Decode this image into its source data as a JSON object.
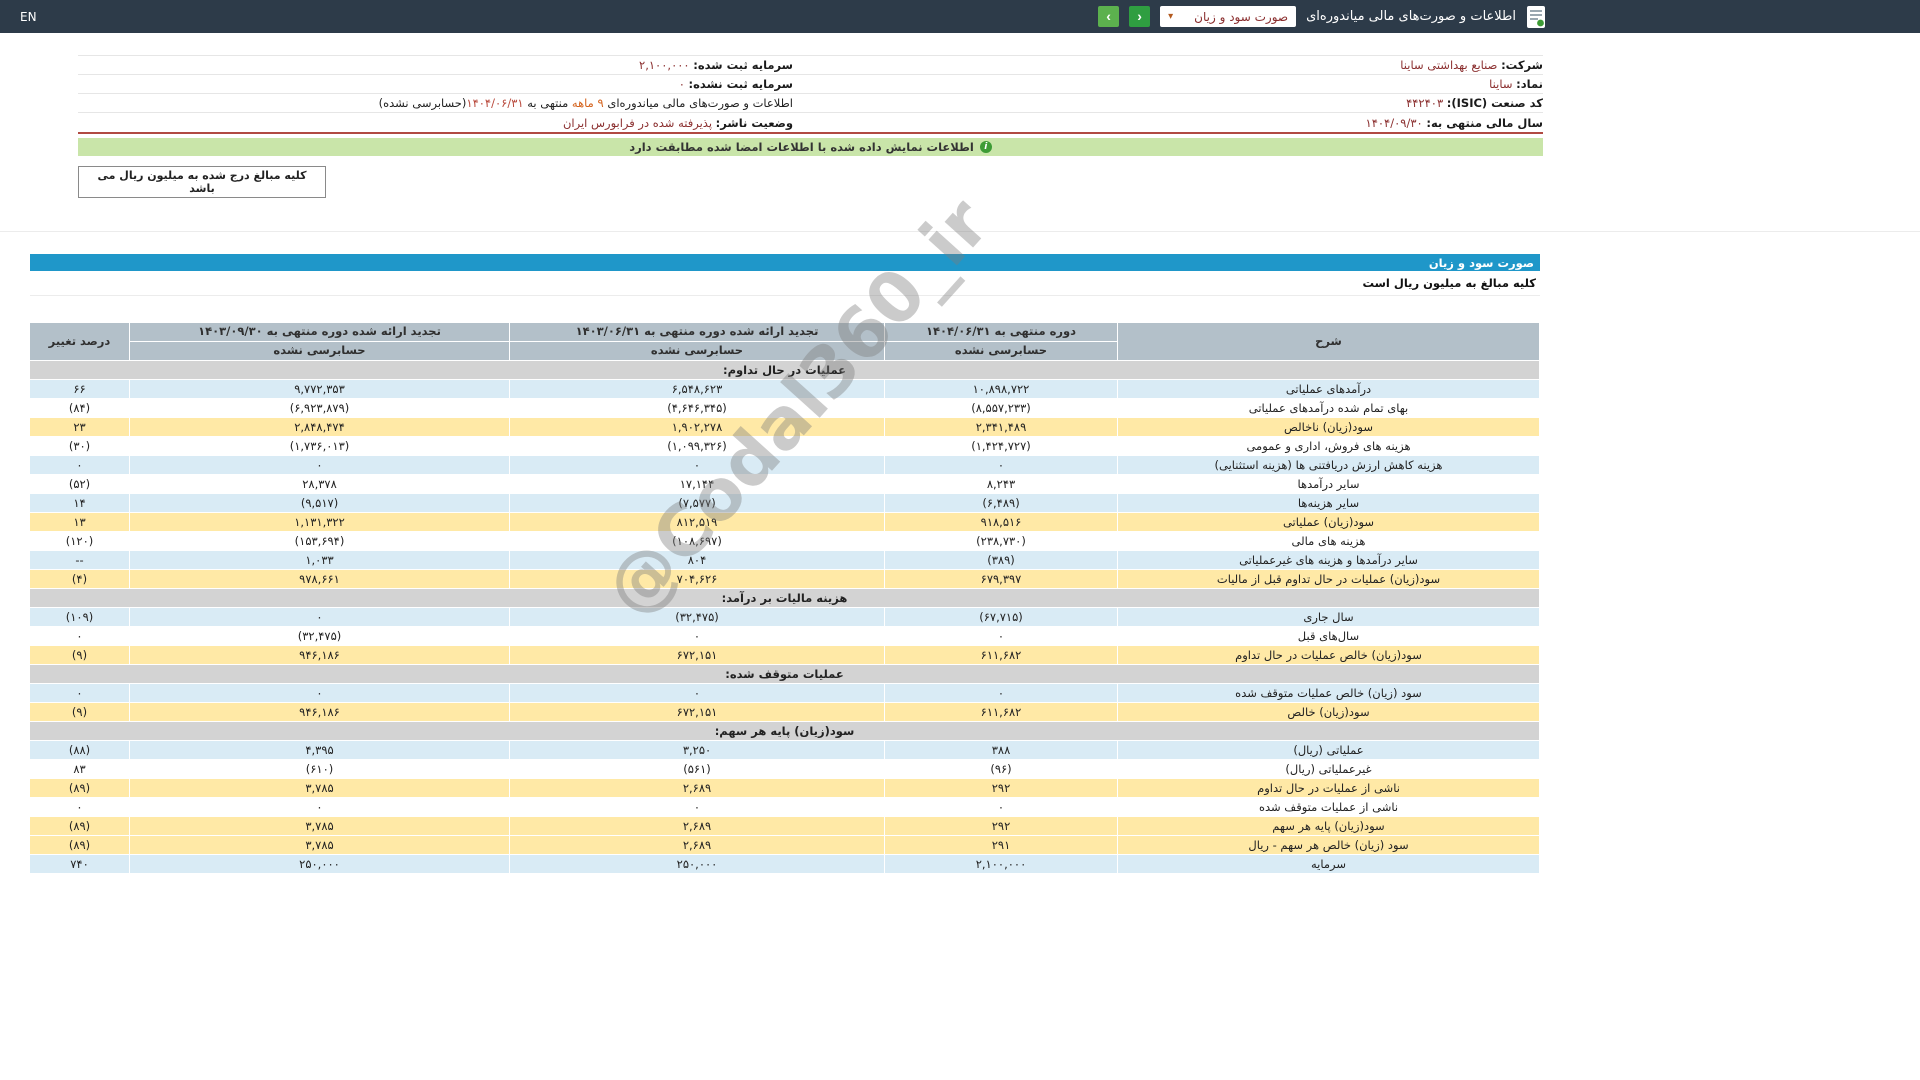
{
  "topbar": {
    "title": "اطلاعات و صورت‌های مالی میاندوره‌ای",
    "statement_select": "صورت سود و زیان",
    "lang_label": "EN",
    "nav": {
      "next": "›",
      "prev": "‹"
    }
  },
  "company": {
    "right": [
      {
        "label": "شرکت:",
        "value": "صنایع بهداشتی ساینا"
      },
      {
        "label": "نماد:",
        "value": "ساینا"
      },
      {
        "label": "کد صنعت (ISIC):",
        "value": "۴۴۲۴۰۳"
      },
      {
        "label": "سال مالی منتهی به:",
        "value": "۱۴۰۴/۰۹/۳۰"
      }
    ],
    "left": [
      {
        "label": "سرمایه ثبت شده:",
        "value": "۲,۱۰۰,۰۰۰"
      },
      {
        "label": "سرمایه ثبت نشده:",
        "value": "۰"
      },
      {
        "label": "اطلاعات و صورت‌های مالی میاندوره‌ای",
        "period": "۹ ماهه",
        "mid": "منتهی به",
        "date": "۱۴۰۴/۰۶/۳۱",
        "note": "(حسابرسی نشده)"
      },
      {
        "label": "وضعیت ناشر:",
        "value": "پذیرفته شده در فرابورس ایران"
      }
    ]
  },
  "banner": {
    "text": "اطلاعات نمایش داده شده با اطلاعات امضا شده مطابقت دارد",
    "icon": "i"
  },
  "unit_note": "کلیه مبالغ درج شده به میلیون ریال می باشد",
  "statement": {
    "title": "صورت سود و زیان",
    "unit_row": "کلیه مبالغ به میلیون ریال است",
    "columns": {
      "desc": "شرح",
      "p1": "دوره منتهی به ۱۴۰۴/۰۶/۳۱",
      "p2": "تجدید ارائه شده دوره منتهی به ۱۴۰۳/۰۶/۳۱",
      "p3": "تجدید ارائه شده دوره منتهی به ۱۴۰۳/۰۹/۳۰",
      "audit1": "حسابرسی نشده",
      "audit2": "حسابرسی نشده",
      "audit3": "حسابرسی نشده",
      "pct": "درصد تغییر"
    },
    "rows": [
      {
        "type": "section",
        "label": "عملیات در حال تداوم:"
      },
      {
        "type": "blue",
        "label": "درآمدهای عملیاتی",
        "v1": "۱۰,۸۹۸,۷۲۲",
        "v2": "۶,۵۴۸,۶۲۳",
        "v3": "۹,۷۷۲,۳۵۳",
        "pct": "۶۶"
      },
      {
        "type": "white",
        "label": "بهای تمام شده درآمدهای عملیاتی",
        "v1": "(۸,۵۵۷,۲۳۳)",
        "v2": "(۴,۶۴۶,۳۴۵)",
        "v3": "(۶,۹۲۳,۸۷۹)",
        "pct": "(۸۴)"
      },
      {
        "type": "yellow",
        "label": "سود(زیان) ناخالص",
        "v1": "۲,۳۴۱,۴۸۹",
        "v2": "۱,۹۰۲,۲۷۸",
        "v3": "۲,۸۴۸,۴۷۴",
        "pct": "۲۳"
      },
      {
        "type": "white",
        "label": "هزینه های فروش، اداری و عمومی",
        "v1": "(۱,۴۲۴,۷۲۷)",
        "v2": "(۱,۰۹۹,۳۲۶)",
        "v3": "(۱,۷۳۶,۰۱۳)",
        "pct": "(۳۰)"
      },
      {
        "type": "blue",
        "label": "هزینه کاهش ارزش دریافتنی ها (هزینه استثنایی)",
        "v1": "۰",
        "v2": "۰",
        "v3": "۰",
        "pct": "۰"
      },
      {
        "type": "white",
        "label": "سایر درآمدها",
        "v1": "۸,۲۴۳",
        "v2": "۱۷,۱۴۴",
        "v3": "۲۸,۳۷۸",
        "pct": "(۵۲)"
      },
      {
        "type": "blue",
        "label": "سایر هزینه‌ها",
        "v1": "(۶,۴۸۹)",
        "v2": "(۷,۵۷۷)",
        "v3": "(۹,۵۱۷)",
        "pct": "۱۴"
      },
      {
        "type": "yellow",
        "label": "سود(زیان) عملیاتی",
        "v1": "۹۱۸,۵۱۶",
        "v2": "۸۱۲,۵۱۹",
        "v3": "۱,۱۳۱,۳۲۲",
        "pct": "۱۳"
      },
      {
        "type": "white",
        "label": "هزینه های مالی",
        "v1": "(۲۳۸,۷۳۰)",
        "v2": "(۱۰۸,۶۹۷)",
        "v3": "(۱۵۳,۶۹۴)",
        "pct": "(۱۲۰)"
      },
      {
        "type": "blue",
        "label": "سایر درآمدها و هزینه های غیرعملیاتی",
        "v1": "(۳۸۹)",
        "v2": "۸۰۴",
        "v3": "۱,۰۳۳",
        "pct": "--"
      },
      {
        "type": "yellow",
        "label": "سود(زیان) عملیات در حال تداوم قبل از مالیات",
        "v1": "۶۷۹,۳۹۷",
        "v2": "۷۰۴,۶۲۶",
        "v3": "۹۷۸,۶۶۱",
        "pct": "(۴)"
      },
      {
        "type": "section",
        "label": "هزینه مالیات بر درآمد:"
      },
      {
        "type": "blue",
        "label": "سال جاری",
        "v1": "(۶۷,۷۱۵)",
        "v2": "(۳۲,۴۷۵)",
        "v3": "۰",
        "pct": "(۱۰۹)"
      },
      {
        "type": "white",
        "label": "سال‌های قبل",
        "v1": "۰",
        "v2": "۰",
        "v3": "(۳۲,۴۷۵)",
        "pct": "۰"
      },
      {
        "type": "yellow",
        "label": "سود(زیان) خالص عملیات در حال تداوم",
        "v1": "۶۱۱,۶۸۲",
        "v2": "۶۷۲,۱۵۱",
        "v3": "۹۴۶,۱۸۶",
        "pct": "(۹)"
      },
      {
        "type": "section",
        "label": "عملیات متوقف شده:"
      },
      {
        "type": "blue",
        "label": "سود (زیان) خالص عملیات متوقف شده",
        "v1": "۰",
        "v2": "۰",
        "v3": "۰",
        "pct": "۰"
      },
      {
        "type": "yellow",
        "label": "سود(زیان) خالص",
        "v1": "۶۱۱,۶۸۲",
        "v2": "۶۷۲,۱۵۱",
        "v3": "۹۴۶,۱۸۶",
        "pct": "(۹)"
      },
      {
        "type": "section",
        "label": "سود(زیان) پایه هر سهم:"
      },
      {
        "type": "blue",
        "label": "عملیاتی (ریال)",
        "v1": "۳۸۸",
        "v2": "۳,۲۵۰",
        "v3": "۴,۳۹۵",
        "pct": "(۸۸)"
      },
      {
        "type": "white",
        "label": "غیرعملیاتی (ریال)",
        "v1": "(۹۶)",
        "v2": "(۵۶۱)",
        "v3": "(۶۱۰)",
        "pct": "۸۳"
      },
      {
        "type": "yellow",
        "label": "ناشی از عملیات در حال تداوم",
        "v1": "۲۹۲",
        "v2": "۲,۶۸۹",
        "v3": "۳,۷۸۵",
        "pct": "(۸۹)"
      },
      {
        "type": "white",
        "label": "ناشی از عملیات متوقف شده",
        "v1": "۰",
        "v2": "۰",
        "v3": "۰",
        "pct": "۰"
      },
      {
        "type": "yellow",
        "label": "سود(زیان) پایه هر سهم",
        "v1": "۲۹۲",
        "v2": "۲,۶۸۹",
        "v3": "۳,۷۸۵",
        "pct": "(۸۹)"
      },
      {
        "type": "yellow",
        "label": "سود (زیان) خالص هر سهم - ریال",
        "v1": "۲۹۱",
        "v2": "۲,۶۸۹",
        "v3": "۳,۷۸۵",
        "pct": "(۸۹)"
      },
      {
        "type": "blue",
        "label": "سرمایه",
        "v1": "۲,۱۰۰,۰۰۰",
        "v2": "۲۵۰,۰۰۰",
        "v3": "۲۵۰,۰۰۰",
        "pct": "۷۴۰"
      }
    ]
  },
  "watermark": "@Codal360_ir",
  "colors": {
    "topbar_bg": "#2d3b49",
    "section_bar_bg": "#1f97c9",
    "header_cell_bg": "#b3c0c9",
    "row_blue": "#d9ebf5",
    "row_yellow": "#ffe9a6",
    "row_section": "#d3d3d3",
    "banner_bg": "#c9e5a9",
    "negative_red": "#d40000",
    "value_maroon": "#8b2f2f",
    "nav_green": "#2f9e41"
  }
}
